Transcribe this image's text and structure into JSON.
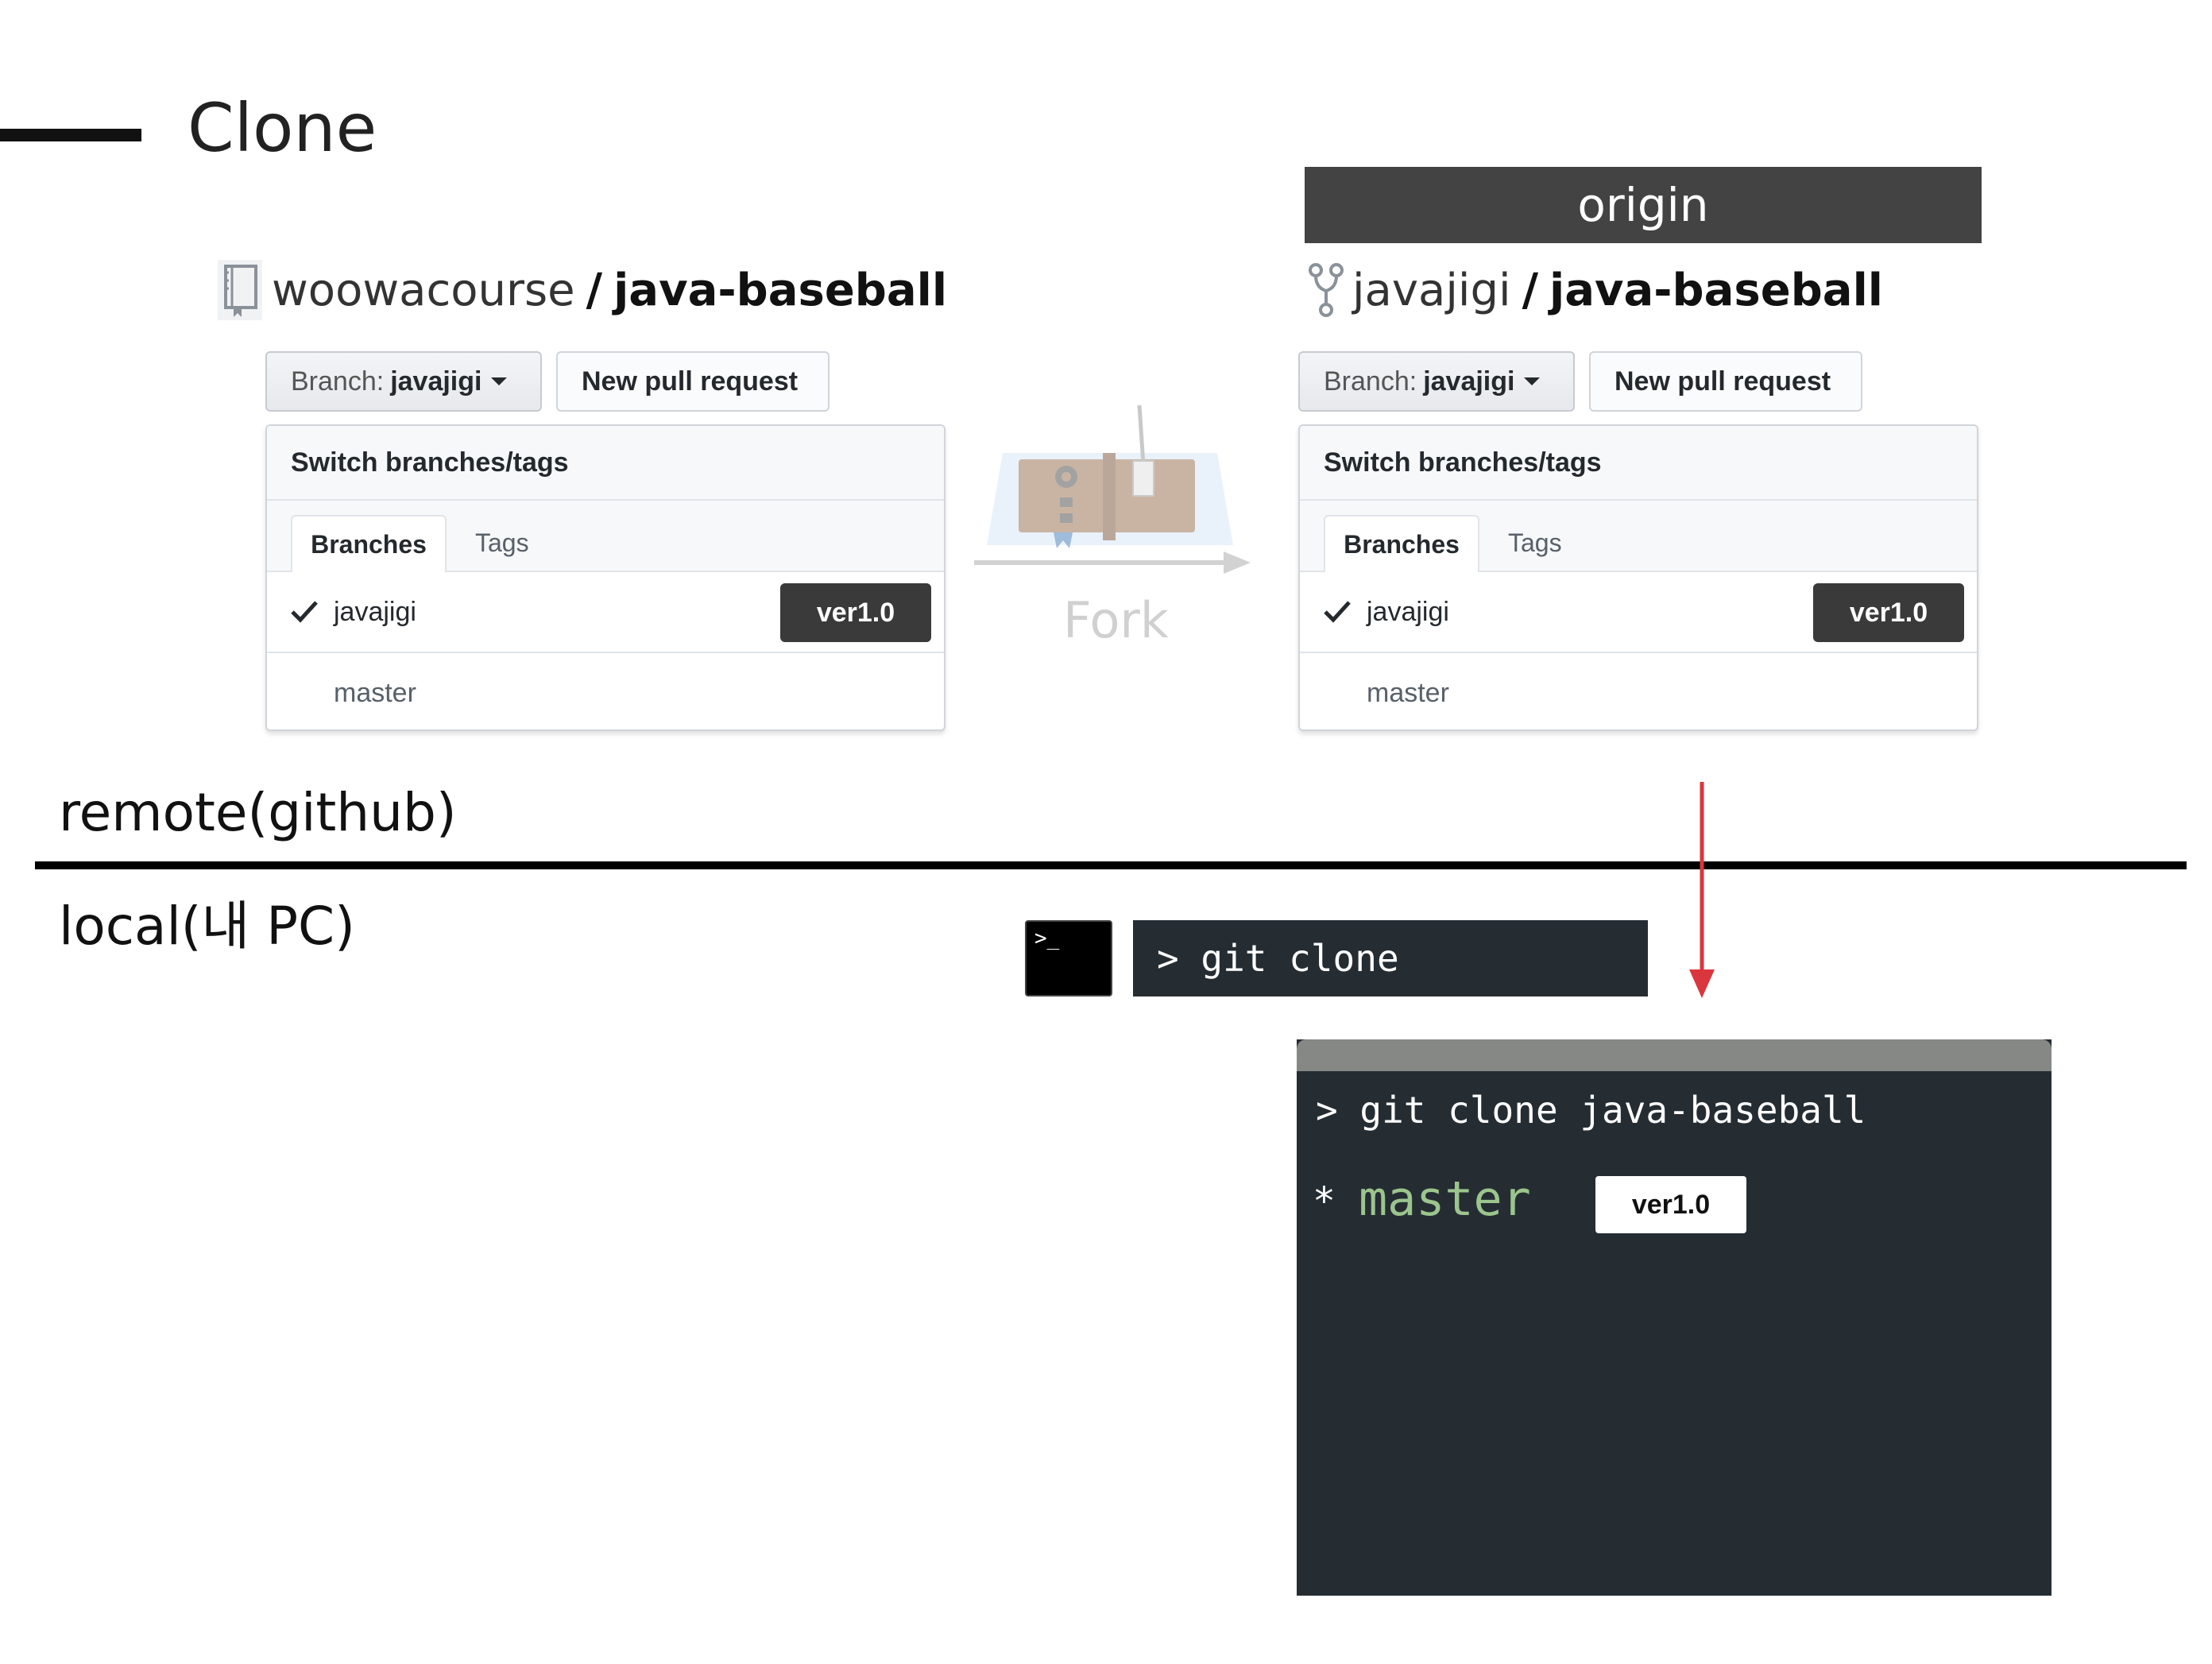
{
  "slide": {
    "title": "Clone"
  },
  "origin_label": "origin",
  "upstream": {
    "owner": "woowacourse",
    "separator": "/",
    "repo": "java-baseball",
    "icon": "repo-book-icon",
    "branch_label": "Branch:",
    "branch_value": "javajigi",
    "new_pr": "New pull request",
    "dropdown": {
      "header": "Switch branches/tags",
      "tabs": [
        "Branches",
        "Tags"
      ],
      "items": [
        {
          "name": "javajigi",
          "selected": true,
          "tag": "ver1.0"
        },
        {
          "name": "master",
          "selected": false
        }
      ]
    }
  },
  "fork": {
    "owner": "javajigi",
    "separator": "/",
    "repo": "java-baseball",
    "icon": "repo-forked-icon",
    "branch_label": "Branch:",
    "branch_value": "javajigi",
    "new_pr": "New pull request",
    "dropdown": {
      "header": "Switch branches/tags",
      "tabs": [
        "Branches",
        "Tags"
      ],
      "items": [
        {
          "name": "javajigi",
          "selected": true,
          "tag": "ver1.0"
        },
        {
          "name": "master",
          "selected": false
        }
      ]
    }
  },
  "fork_arrow": {
    "label": "Fork"
  },
  "zones": {
    "remote": "remote(github)",
    "local": "local(내 PC)"
  },
  "command": {
    "icon_text": ">_",
    "text": "> git clone"
  },
  "terminal": {
    "line1": "> git clone java-baseball",
    "marker": "*",
    "branch": "master",
    "tag": "ver1.0"
  },
  "colors": {
    "arrow_red": "#d9363e",
    "terminal_bg": "#252d33",
    "branch_green": "#9cc58d",
    "origin_banner": "#434343"
  }
}
